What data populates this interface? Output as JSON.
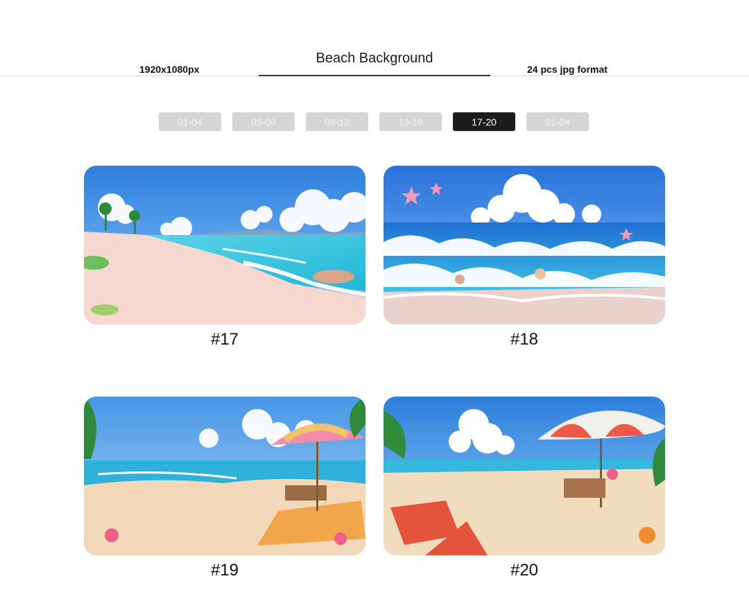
{
  "header": {
    "title": "Beach Background",
    "resolution": "1920x1080px",
    "format": "24 pcs jpg format"
  },
  "tabs": [
    {
      "label": "01-04",
      "active": false
    },
    {
      "label": "05-09",
      "active": false
    },
    {
      "label": "09-12",
      "active": false
    },
    {
      "label": "13-16",
      "active": false
    },
    {
      "label": "17-20",
      "active": true
    },
    {
      "label": "21-24",
      "active": false
    }
  ],
  "cards": [
    {
      "label": "#17"
    },
    {
      "label": "#18"
    },
    {
      "label": "#19"
    },
    {
      "label": "#20"
    }
  ],
  "colors": {
    "active_tab": "#1d1b1c",
    "inactive_tab": "#d4d6d5",
    "sky": "#3f8fe6",
    "sea": "#33c2e0",
    "sand": "#f4d6cf"
  }
}
